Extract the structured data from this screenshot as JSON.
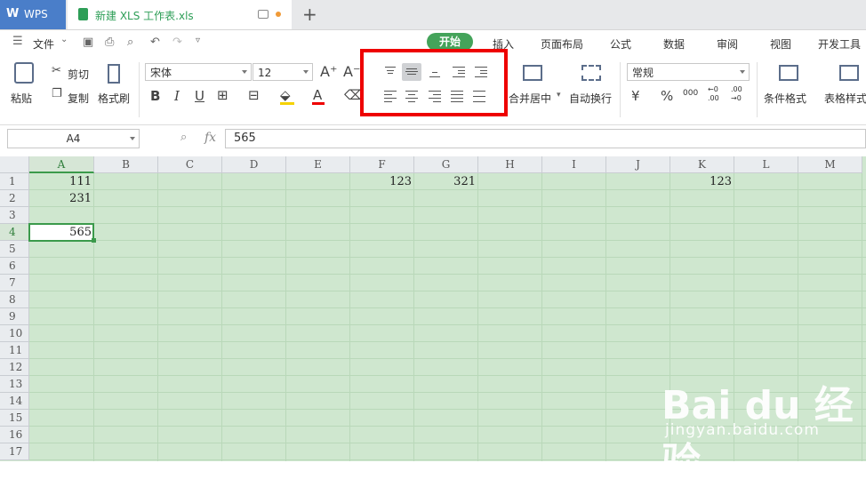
{
  "titlebar": {
    "app_label": "WPS",
    "doc_tab": "新建 XLS 工作表.xls",
    "new_tab": "+"
  },
  "menubar": {
    "file": "文件",
    "tabs": [
      "开始",
      "插入",
      "页面布局",
      "公式",
      "数据",
      "审阅",
      "视图",
      "开发工具"
    ],
    "active_tab": "开始"
  },
  "ribbon": {
    "paste": "粘贴",
    "cut": "剪切",
    "copy": "复制",
    "format_painter": "格式刷",
    "font_name": "宋体",
    "font_size": "12",
    "bold": "B",
    "italic": "I",
    "underline": "U",
    "merge_center": "合并居中",
    "wrap_text": "自动换行",
    "number_format": "常规",
    "percent": "%",
    "thousands": "000",
    "inc_decimal": "←0 .00",
    "dec_decimal": ".00 →0",
    "conditional_format": "条件格式",
    "table_style": "表格样式"
  },
  "formula_bar": {
    "name_box": "A4",
    "fx": "fx",
    "value": "565"
  },
  "grid": {
    "columns": [
      "A",
      "B",
      "C",
      "D",
      "E",
      "F",
      "G",
      "H",
      "I",
      "J",
      "K",
      "L",
      "M"
    ],
    "rows": [
      "1",
      "2",
      "3",
      "4",
      "5",
      "6",
      "7",
      "8",
      "9",
      "10",
      "11",
      "12",
      "13",
      "14",
      "15",
      "16",
      "17"
    ],
    "cells": {
      "A1": "111",
      "A2": "231",
      "A4": "565",
      "F1": "123",
      "G1": "321",
      "K1": "123"
    },
    "active_cell": "A4"
  },
  "watermark": {
    "logo": "Bai du 经验",
    "url": "jingyan.baidu.com"
  },
  "colors": {
    "accent_green": "#44a35a",
    "grid_green": "#cfe7cf",
    "highlight_red": "#e00000",
    "wps_blue": "#4a7ec9"
  }
}
